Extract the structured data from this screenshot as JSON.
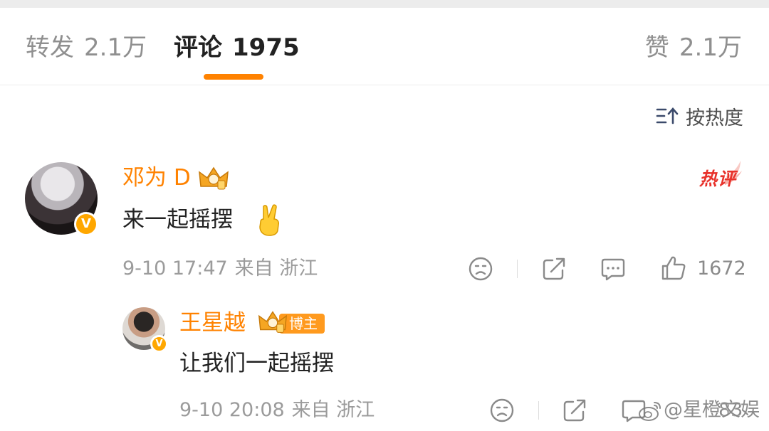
{
  "tabs": {
    "repost": {
      "label": "转发",
      "count": "2.1万"
    },
    "comments": {
      "label": "评论",
      "count": "1975"
    },
    "likes": {
      "label": "赞",
      "count": "2.1万"
    }
  },
  "sort": {
    "label": "按热度",
    "icon": "sort-hot-icon"
  },
  "comments": [
    {
      "username": "邓为 D",
      "text": "来一起摇摆",
      "emoji": "victory-hand-icon",
      "date": "9-10 17:47",
      "location": "来自 浙江",
      "badge": "热评",
      "likes": "1672"
    }
  ],
  "reply": {
    "username": "王星越",
    "tag": "博主",
    "text": "让我们一起摇摆",
    "date": "9-10 20:08",
    "location": "来自 浙江",
    "likes": "83"
  },
  "verified_badge": "V",
  "watermark": "@星橙文娱",
  "colors": {
    "accent": "#ff8200",
    "hot": "#e8322b",
    "muted": "#9b9b9b",
    "text": "#222222"
  }
}
